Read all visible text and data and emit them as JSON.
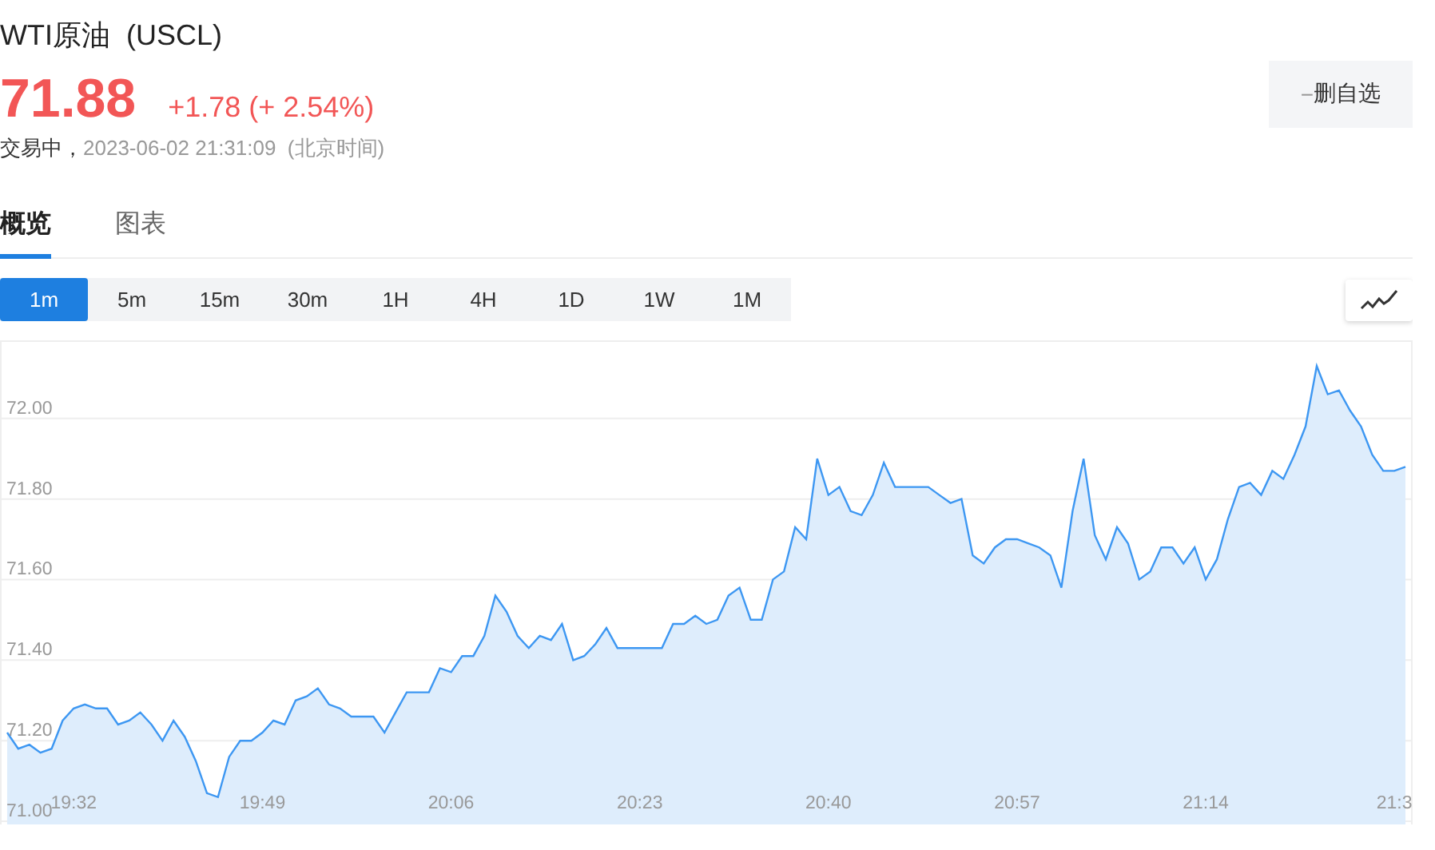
{
  "header": {
    "title": "WTI原油  (USCL)",
    "price": "71.88",
    "change": "+1.78 (+ 2.54%)",
    "status": "交易中，",
    "time": "2023-06-02 21:31:09  (北京时间)",
    "watch_button": {
      "icon": "−",
      "label": "删自选"
    }
  },
  "tabs": [
    {
      "label": "概览",
      "selected": true
    },
    {
      "label": "图表",
      "selected": false
    }
  ],
  "intervals": [
    {
      "label": "1m",
      "selected": true
    },
    {
      "label": "5m",
      "selected": false
    },
    {
      "label": "15m",
      "selected": false
    },
    {
      "label": "30m",
      "selected": false
    },
    {
      "label": "1H",
      "selected": false
    },
    {
      "label": "4H",
      "selected": false
    },
    {
      "label": "1D",
      "selected": false
    },
    {
      "label": "1W",
      "selected": false
    },
    {
      "label": "1M",
      "selected": false
    }
  ],
  "chart": {
    "chart_data": {
      "type": "area",
      "grid": true,
      "ylim": [
        71.0,
        72.19
      ],
      "categories": [
        null,
        null,
        null,
        null,
        null,
        null,
        "19:32",
        null,
        null,
        null,
        null,
        null,
        null,
        null,
        null,
        null,
        null,
        null,
        null,
        null,
        null,
        null,
        null,
        "19:49",
        null,
        null,
        null,
        null,
        null,
        null,
        null,
        null,
        null,
        null,
        null,
        null,
        null,
        null,
        null,
        null,
        "20:06",
        null,
        null,
        null,
        null,
        null,
        null,
        null,
        null,
        null,
        null,
        null,
        null,
        null,
        null,
        null,
        null,
        "20:23",
        null,
        null,
        null,
        null,
        null,
        null,
        null,
        null,
        null,
        null,
        null,
        null,
        null,
        null,
        null,
        null,
        "20:40",
        null,
        null,
        null,
        null,
        null,
        null,
        null,
        null,
        null,
        null,
        null,
        null,
        null,
        null,
        null,
        null,
        "20:57",
        null,
        null,
        null,
        null,
        null,
        null,
        null,
        null,
        null,
        null,
        null,
        null,
        null,
        null,
        null,
        null,
        "21:14",
        null,
        null,
        null,
        null,
        null,
        null,
        null,
        null,
        null,
        null,
        null,
        null,
        null,
        null,
        null,
        null,
        "21:3",
        null
      ],
      "yticks": [
        {
          "value": 71.0,
          "label": "71.00"
        },
        {
          "value": 71.2,
          "label": "71.20"
        },
        {
          "value": 71.4,
          "label": "71.40"
        },
        {
          "value": 71.6,
          "label": "71.60"
        },
        {
          "value": 71.8,
          "label": "71.80"
        },
        {
          "value": 72.0,
          "label": "72.00"
        }
      ],
      "series": [
        {
          "color": "#3d97f2",
          "values": [
            71.22,
            71.18,
            71.19,
            71.17,
            71.18,
            71.25,
            71.28,
            71.29,
            71.28,
            71.28,
            71.24,
            71.25,
            71.27,
            71.24,
            71.2,
            71.25,
            71.21,
            71.15,
            71.07,
            71.06,
            71.16,
            71.2,
            71.2,
            71.22,
            71.25,
            71.24,
            71.3,
            71.31,
            71.33,
            71.29,
            71.28,
            71.26,
            71.26,
            71.26,
            71.22,
            71.27,
            71.32,
            71.32,
            71.32,
            71.38,
            71.37,
            71.41,
            71.41,
            71.46,
            71.56,
            71.52,
            71.46,
            71.43,
            71.46,
            71.45,
            71.49,
            71.4,
            71.41,
            71.44,
            71.48,
            71.43,
            71.43,
            71.43,
            71.43,
            71.43,
            71.49,
            71.49,
            71.51,
            71.49,
            71.5,
            71.56,
            71.58,
            71.5,
            71.5,
            71.6,
            71.62,
            71.73,
            71.7,
            71.9,
            71.81,
            71.83,
            71.77,
            71.76,
            71.81,
            71.89,
            71.83,
            71.83,
            71.83,
            71.83,
            71.81,
            71.79,
            71.8,
            71.66,
            71.64,
            71.68,
            71.7,
            71.7,
            71.69,
            71.68,
            71.66,
            71.58,
            71.77,
            71.9,
            71.71,
            71.65,
            71.73,
            71.69,
            71.6,
            71.62,
            71.68,
            71.68,
            71.64,
            71.68,
            71.6,
            71.65,
            71.75,
            71.83,
            71.84,
            71.81,
            71.87,
            71.85,
            71.91,
            71.98,
            72.13,
            72.06,
            72.07,
            72.02,
            71.98,
            71.91,
            71.87,
            71.87,
            71.88
          ]
        }
      ]
    }
  }
}
